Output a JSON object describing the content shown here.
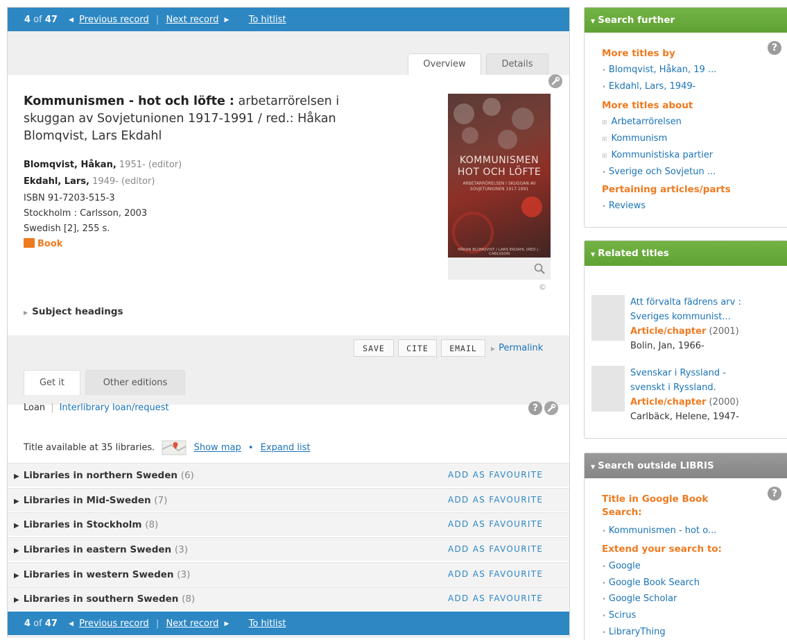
{
  "nav": {
    "position_current": "4",
    "position_of": "of",
    "position_total": "47",
    "previous": "Previous record",
    "next": "Next record",
    "hitlist": "To hitlist"
  },
  "tabs": {
    "overview": "Overview",
    "details": "Details"
  },
  "record": {
    "title_main": "Kommunismen - hot och löfte :",
    "title_rest": " arbetarrörelsen i skuggan av Sovjetunionen 1917-1991 / red.: Håkan Blomqvist, Lars Ekdahl",
    "authors": [
      {
        "name": "Blomqvist, Håkan,",
        "detail": "1951- (editor)"
      },
      {
        "name": "Ekdahl, Lars,",
        "detail": "1949- (editor)"
      }
    ],
    "isbn": "ISBN 91-7203-515-3",
    "publisher": "Stockholm : Carlsson, 2003",
    "language_pages": "Swedish [2], 255 s.",
    "type": "Book",
    "cover_line1": "KOMMUNISMEN",
    "cover_line2": "HOT OCH LÖFTE",
    "cover_sub": "ARBETARRÖRELSEN I SKUGGAN AV SOVJETUNIONEN 1917-1991",
    "cover_bottom": "HÅKAN BLOMQVIST / LARS EKDAHL (RED.) · CARLSSON",
    "copyright": "©"
  },
  "subject_headings": "Subject headings",
  "actions": {
    "save": "SAVE",
    "cite": "CITE",
    "email": "EMAIL",
    "permalink": "Permalink"
  },
  "get_tabs": {
    "get_it": "Get it",
    "other_editions": "Other editions"
  },
  "loan": {
    "loan": "Loan",
    "ill": "Interlibrary loan/request"
  },
  "availability": {
    "text": "Title available at 35 libraries.",
    "show_map": "Show map",
    "expand": "Expand list"
  },
  "libraries": [
    {
      "name": "Libraries in northern Sweden",
      "count": "(6)"
    },
    {
      "name": "Libraries in Mid-Sweden",
      "count": "(7)"
    },
    {
      "name": "Libraries in Stockholm",
      "count": "(8)"
    },
    {
      "name": "Libraries in eastern Sweden",
      "count": "(3)"
    },
    {
      "name": "Libraries in western Sweden",
      "count": "(3)"
    },
    {
      "name": "Libraries in southern Sweden",
      "count": "(8)"
    }
  ],
  "favourite_label": "ADD AS FAVOURITE",
  "search_further": {
    "header": "Search further",
    "more_by": "More titles by",
    "by_items": [
      "Blomqvist, Håkan, 19 ...",
      "Ekdahl, Lars, 1949-"
    ],
    "more_about": "More titles about",
    "about_items": [
      "Arbetarrörelsen",
      "Kommunism",
      "Kommunistiska partier",
      "Sverige och Sovjetun ..."
    ],
    "pertaining": "Pertaining articles/parts",
    "pertaining_items": [
      "Reviews"
    ]
  },
  "related": {
    "header": "Related titles",
    "items": [
      {
        "title1": "Att förvalta fädrens arv :",
        "title2": "Sveriges kommunist...",
        "type": "Article/chapter",
        "year": "(2001)",
        "author": "Bolin, Jan, 1966-"
      },
      {
        "title1": "Svenskar i Ryssland -",
        "title2": "svenskt i Ryssland.",
        "type": "Article/chapter",
        "year": "(2000)",
        "author": "Carlbäck, Helene, 1947-"
      }
    ]
  },
  "outside": {
    "header": "Search outside LIBRIS",
    "google_book_title1": "Title in Google Book",
    "google_book_title2": "Search:",
    "google_book_items": [
      "Kommunismen - hot o..."
    ],
    "extend": "Extend your search to:",
    "extend_items": [
      "Google",
      "Google Book Search",
      "Google Scholar",
      "Scirus",
      "LibraryThing"
    ]
  },
  "colors": {
    "nav_blue": "#2d87c3",
    "green": "#6aad3b",
    "orange": "#ee7a1f",
    "link": "#1a73b8"
  },
  "icons": [
    "triangle-left-icon",
    "triangle-right-icon",
    "help-icon",
    "wrench-icon",
    "book-icon",
    "magnifier-icon",
    "map-icon",
    "expand-plus-icon"
  ]
}
